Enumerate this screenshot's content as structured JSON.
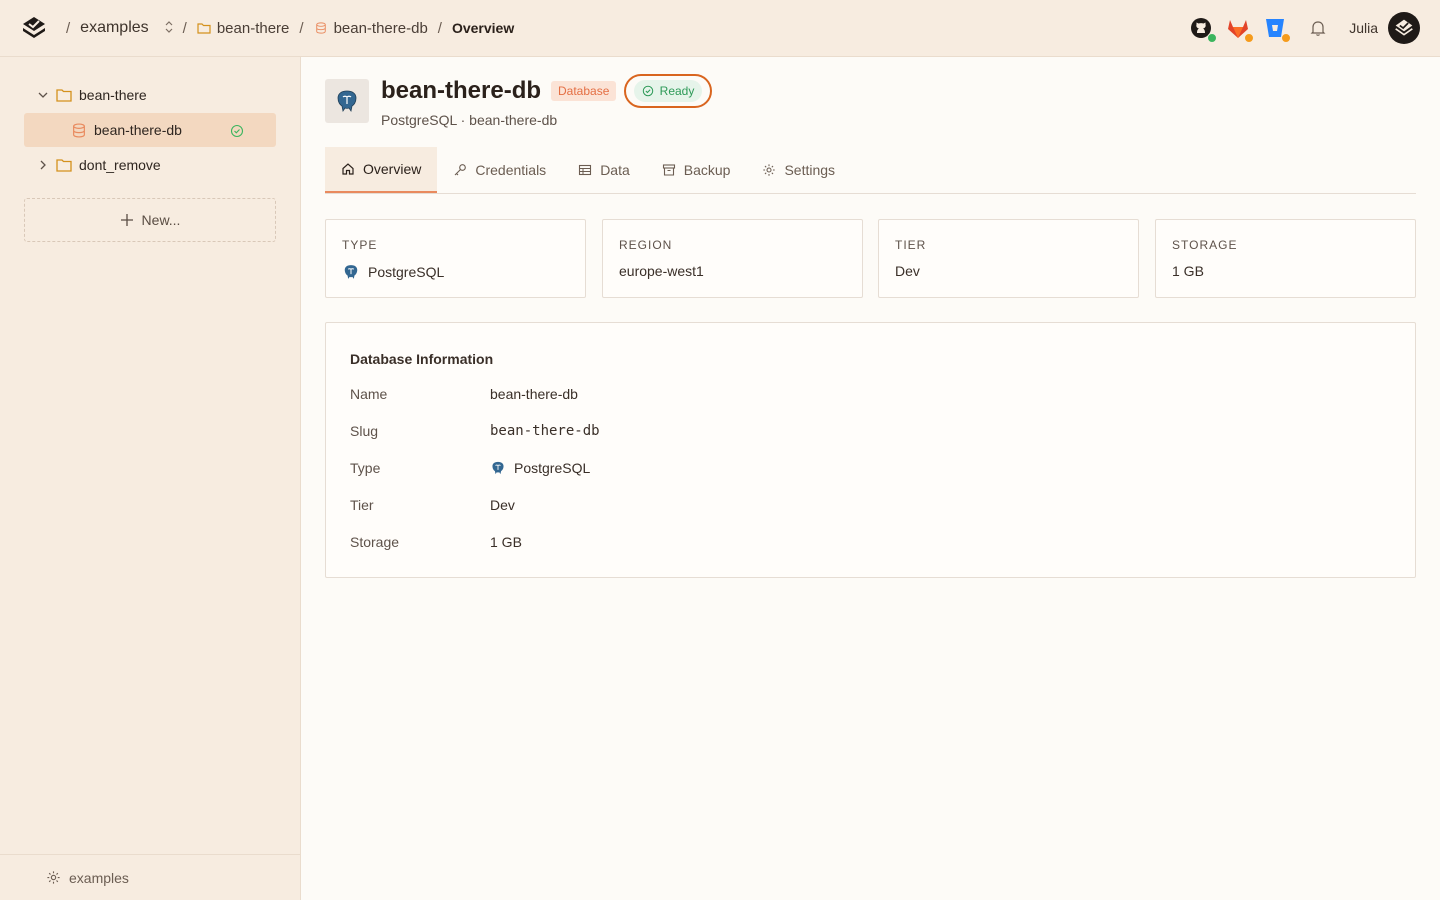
{
  "breadcrumb": {
    "org": "examples",
    "project": "bean-there",
    "resource": "bean-there-db",
    "current": "Overview",
    "separator": "/"
  },
  "topbar": {
    "icons": [
      "github-icon",
      "gitlab-icon",
      "bitbucket-icon",
      "bell-icon"
    ],
    "user_name": "Julia"
  },
  "sidebar": {
    "tree": [
      {
        "label": "bean-there",
        "expanded": true
      },
      {
        "label": "bean-there-db",
        "selected": true,
        "status": "ready"
      },
      {
        "label": "dont_remove",
        "expanded": false
      }
    ],
    "new_label": "New...",
    "footer_label": "examples"
  },
  "resource": {
    "title": "bean-there-db",
    "kind_badge": "Database",
    "status": "Ready",
    "subtitle": "PostgreSQL · bean-there-db"
  },
  "tabs": [
    {
      "label": "Overview",
      "active": true
    },
    {
      "label": "Credentials"
    },
    {
      "label": "Data"
    },
    {
      "label": "Backup"
    },
    {
      "label": "Settings"
    }
  ],
  "stats": [
    {
      "label": "TYPE",
      "value": "PostgreSQL"
    },
    {
      "label": "REGION",
      "value": "europe-west1"
    },
    {
      "label": "TIER",
      "value": "Dev"
    },
    {
      "label": "STORAGE",
      "value": "1 GB"
    }
  ],
  "info": {
    "title": "Database Information",
    "rows": [
      {
        "key": "Name",
        "value": "bean-there-db"
      },
      {
        "key": "Slug",
        "value": "bean-there-db"
      },
      {
        "key": "Type",
        "value": "PostgreSQL"
      },
      {
        "key": "Tier",
        "value": "Dev"
      },
      {
        "key": "Storage",
        "value": "1 GB"
      }
    ]
  },
  "colors": {
    "accent": "#e98a5e",
    "sidebar_bg": "#f7ece0",
    "ready_green": "#2e9a58",
    "highlight_ring": "#d9651f"
  }
}
